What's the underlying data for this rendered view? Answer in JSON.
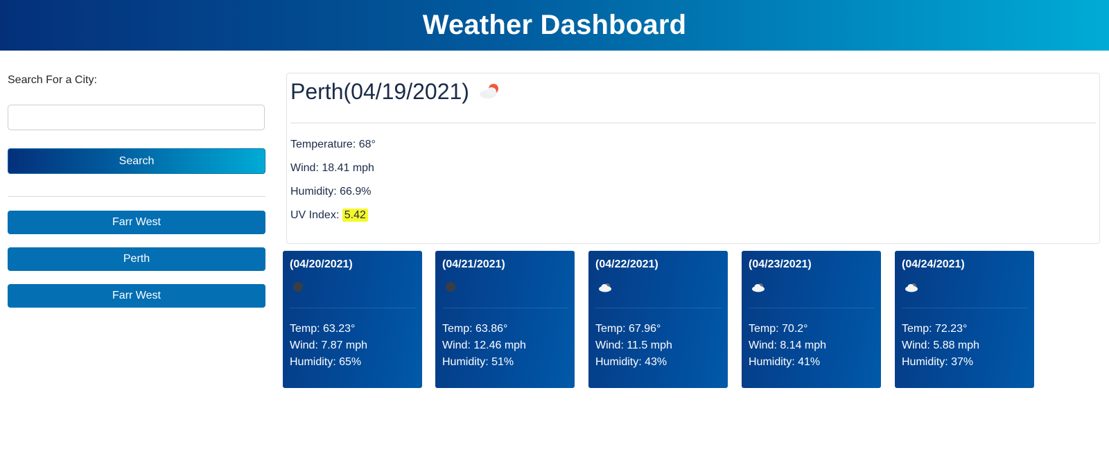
{
  "header": {
    "title": "Weather Dashboard"
  },
  "sidebar": {
    "search_label": "Search For a City:",
    "search_value": "",
    "search_placeholder": "",
    "search_button": "Search",
    "history": [
      "Farr West",
      "Perth",
      "Farr West"
    ]
  },
  "current": {
    "title": "Perth(04/19/2021)",
    "icon": "cloud-sun-icon",
    "temperature": "Temperature: 68°",
    "wind": "Wind: 18.41 mph",
    "humidity": "Humidity: 66.9%",
    "uv_label": "UV Index:",
    "uv_value": "5.42",
    "uv_color": "#f6f928"
  },
  "forecast": [
    {
      "date": "(04/20/2021)",
      "icon": "dark-circle-icon",
      "temp": "Temp: 63.23°",
      "wind": "Wind: 7.87 mph",
      "humidity": "Humidity: 65%"
    },
    {
      "date": "(04/21/2021)",
      "icon": "dark-circle-icon",
      "temp": "Temp: 63.86°",
      "wind": "Wind: 12.46 mph",
      "humidity": "Humidity: 51%"
    },
    {
      "date": "(04/22/2021)",
      "icon": "cloud-icon",
      "temp": "Temp: 67.96°",
      "wind": "Wind: 11.5 mph",
      "humidity": "Humidity: 43%"
    },
    {
      "date": "(04/23/2021)",
      "icon": "cloud-icon",
      "temp": "Temp: 70.2°",
      "wind": "Wind: 8.14 mph",
      "humidity": "Humidity: 41%"
    },
    {
      "date": "(04/24/2021)",
      "icon": "cloud-icon",
      "temp": "Temp: 72.23°",
      "wind": "Wind: 5.88 mph",
      "humidity": "Humidity: 37%"
    }
  ],
  "colors": {
    "header_gradient_start": "#04307a",
    "header_gradient_end": "#00abd6",
    "history_button": "#046fb2",
    "forecast_card": "#063b85"
  }
}
